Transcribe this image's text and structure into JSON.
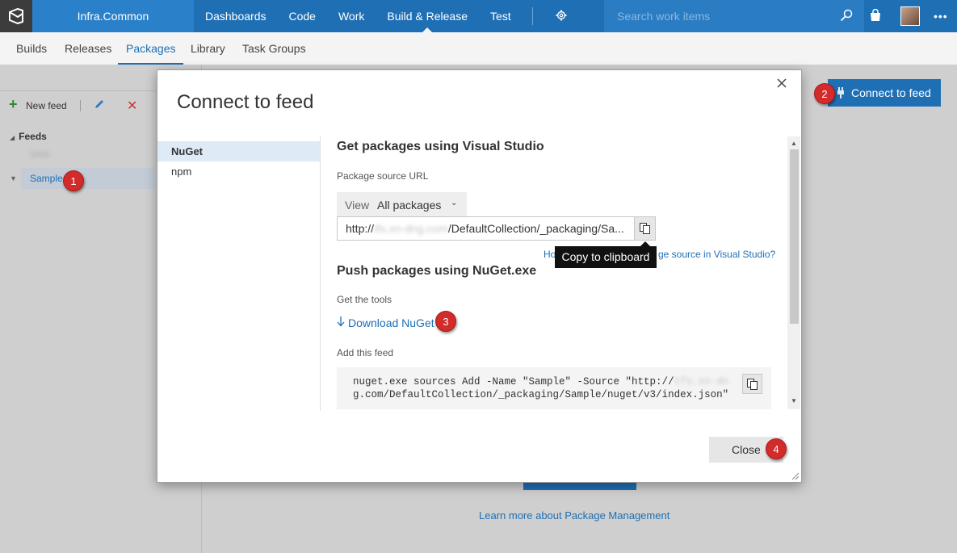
{
  "app": {
    "project": "Infra.Common"
  },
  "nav": {
    "items": [
      {
        "label": "Dashboards"
      },
      {
        "label": "Code"
      },
      {
        "label": "Work"
      },
      {
        "label": "Build & Release"
      },
      {
        "label": "Test"
      }
    ],
    "active": "Build & Release"
  },
  "search": {
    "placeholder": "Search work items"
  },
  "subnav": {
    "tabs": [
      {
        "label": "Builds"
      },
      {
        "label": "Releases"
      },
      {
        "label": "Packages"
      },
      {
        "label": "Library"
      },
      {
        "label": "Task Groups"
      }
    ],
    "active": "Packages"
  },
  "toolbar": {
    "new_feed": "New feed"
  },
  "feeds": {
    "header": "Feeds",
    "items": [
      {
        "label": "DNS"
      },
      {
        "label": "Sample"
      }
    ],
    "selected": "Sample"
  },
  "page": {
    "connect_button": "Connect to feed",
    "learn_more": "Learn more about Package Management"
  },
  "dialog": {
    "title": "Connect to feed",
    "tabs": [
      {
        "label": "NuGet"
      },
      {
        "label": "npm"
      }
    ],
    "selected_tab": "NuGet",
    "vs_heading": "Get packages using Visual Studio",
    "source_url_label": "Package source URL",
    "view_label": "View",
    "view_value": "All packages",
    "url_prefix": "http://",
    "url_host": "tfs.xn-dng.com",
    "url_suffix": "/DefaultCollection/_packaging/Sa...",
    "tooltip": "Copy to clipboard",
    "howto_link_start": "Ho",
    "howto_link_end": "ge source in Visual Studio?",
    "push_heading": "Push packages using NuGet.exe",
    "tools_label": "Get the tools",
    "download_link": "Download NuGet",
    "add_feed_label": "Add this feed",
    "command_line1_start": "nuget.exe sources Add -Name \"Sample\" -Source \"http://",
    "command_line1_blur": "tfs.xn-dn",
    "command_line2": "g.com/DefaultCollection/_packaging/Sample/nuget/v3/index.json\"",
    "close_button": "Close"
  },
  "annotations": {
    "badge1": "1",
    "badge2": "2",
    "badge3": "3",
    "badge4": "4",
    "color": "#d32a2a"
  },
  "colors": {
    "brand": "#1f6fb5",
    "topbar": "#1f6fb5",
    "accent_link": "#1f6fb5"
  }
}
